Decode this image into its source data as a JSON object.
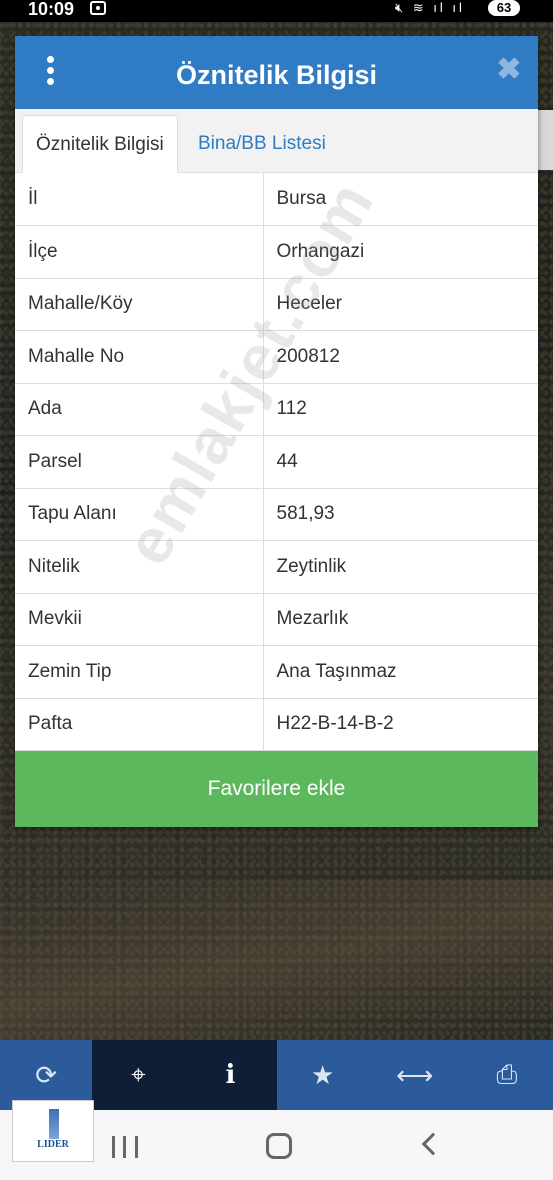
{
  "status_bar": {
    "time": "10:09",
    "battery": "63"
  },
  "dialog": {
    "title": "Öznitelik Bilgisi",
    "close_glyph": "✖",
    "tabs": [
      {
        "label": "Öznitelik Bilgisi"
      },
      {
        "label": "Bina/BB Listesi"
      }
    ],
    "rows": [
      {
        "key": "İl",
        "value": "Bursa"
      },
      {
        "key": "İlçe",
        "value": "Orhangazi"
      },
      {
        "key": "Mahalle/Köy",
        "value": "Heceler"
      },
      {
        "key": "Mahalle No",
        "value": "200812"
      },
      {
        "key": "Ada",
        "value": "112"
      },
      {
        "key": "Parsel",
        "value": "44"
      },
      {
        "key": "Tapu Alanı",
        "value": "581,93"
      },
      {
        "key": "Nitelik",
        "value": "Zeytinlik"
      },
      {
        "key": "Mevkii",
        "value": "Mezarlık"
      },
      {
        "key": "Zemin Tip",
        "value": "Ana Taşınmaz"
      },
      {
        "key": "Pafta",
        "value": "H22-B-14-B-2"
      }
    ],
    "favorite_button": "Favorilere ekle"
  },
  "watermark": "emlakjet.com",
  "toolbar": {
    "items": [
      {
        "icon": "refresh-icon",
        "glyph": "⟳"
      },
      {
        "icon": "crosshair-icon",
        "glyph": "⌖"
      },
      {
        "icon": "info-icon",
        "glyph": "i"
      },
      {
        "icon": "star-icon",
        "glyph": "★"
      },
      {
        "icon": "measure-icon",
        "glyph": "⟷"
      },
      {
        "icon": "print-icon",
        "glyph": "⎙"
      }
    ]
  },
  "logo": {
    "text": "LIDER"
  },
  "colors": {
    "header": "#2f7bc4",
    "favorite_button": "#5cb85c",
    "toolbar": "#2b5b9b",
    "toolbar_active": "#0d1e36"
  }
}
